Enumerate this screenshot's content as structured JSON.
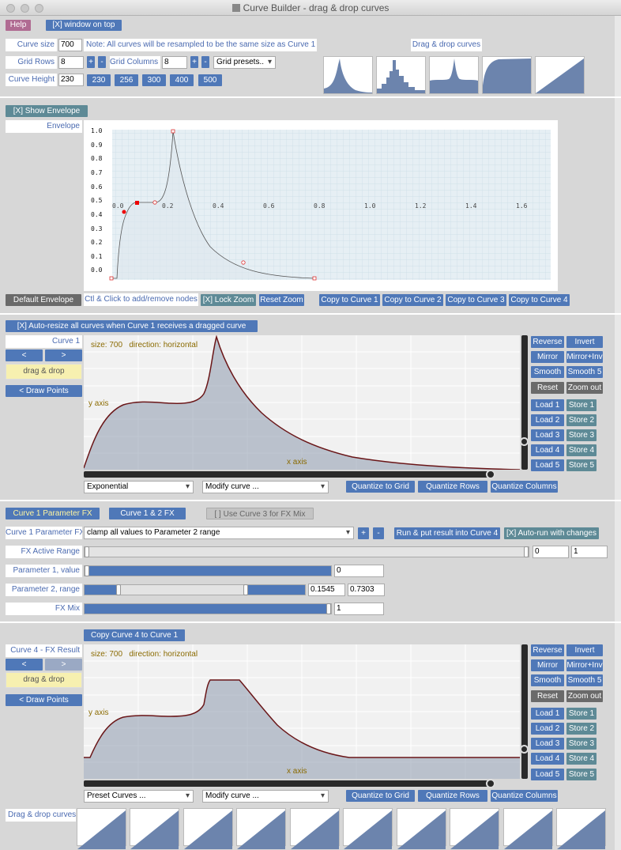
{
  "window": {
    "title": "Curve Builder - drag & drop curves"
  },
  "top": {
    "help": "Help",
    "window_on_top": "[X] window on top",
    "curve_size_label": "Curve size",
    "curve_size_value": "700",
    "note": "Note: All curves will be resampled to be the same size as Curve 1",
    "drag_drop_label": "Drag & drop curves",
    "grid_rows_label": "Grid Rows",
    "grid_rows_value": "8",
    "grid_cols_label": "Grid Columns",
    "grid_cols_value": "8",
    "plus": "+",
    "minus": "-",
    "grid_presets": "Grid presets..",
    "curve_height_label": "Curve Height",
    "curve_height_value": "230",
    "height_presets": [
      "230",
      "256",
      "300",
      "400",
      "500"
    ]
  },
  "envelope": {
    "show_btn": "[X] Show Envelope",
    "label": "Envelope",
    "y_ticks": [
      "1.0",
      "0.9",
      "0.8",
      "0.7",
      "0.6",
      "0.5",
      "0.4",
      "0.3",
      "0.2",
      "0.1",
      "0.0"
    ],
    "x_ticks": [
      "0.0",
      "0.2",
      "0.4",
      "0.6",
      "0.8",
      "1.0",
      "1.2",
      "1.4",
      "1.6"
    ],
    "default_btn": "Default Envelope",
    "hint": "Ctl & Click to add/remove nodes",
    "lock_zoom": "[X] Lock Zoom",
    "reset_zoom": "Reset Zoom",
    "copy_btns": [
      "Copy to Curve 1",
      "Copy to Curve 2",
      "Copy to Curve 3",
      "Copy to Curve 4"
    ]
  },
  "curve1": {
    "auto_resize": "[X] Auto-resize all curves when Curve 1 receives a dragged curve",
    "label": "Curve 1",
    "prev": "<",
    "next": ">",
    "drag_drop": "drag & drop",
    "draw_points": "< Draw Points",
    "info_size": "size: 700",
    "info_dir": "direction: horizontal",
    "y_axis": "y axis",
    "x_axis": "x axis",
    "select_left": "Exponential",
    "select_modify": "Modify curve ...",
    "quantize_grid": "Quantize to Grid",
    "quantize_rows": "Quantize Rows",
    "quantize_cols": "Quantize Columns",
    "side": [
      [
        "Reverse",
        "Invert"
      ],
      [
        "Mirror",
        "Mirror+Inv"
      ],
      [
        "Smooth",
        "Smooth 5"
      ],
      [
        "Reset",
        "Zoom out"
      ],
      [
        "Load 1",
        "Store 1"
      ],
      [
        "Load 2",
        "Store 2"
      ],
      [
        "Load 3",
        "Store 3"
      ],
      [
        "Load 4",
        "Store 4"
      ],
      [
        "Load 5",
        "Store 5"
      ]
    ]
  },
  "fx": {
    "tab1": "Curve 1 Parameter FX",
    "tab2": "Curve 1 & 2 FX",
    "tab3": "[ ] Use Curve 3 for FX Mix",
    "param_fx_label": "Curve 1 Parameter FX",
    "param_fx_value": "clamp all values to Parameter 2 range",
    "plus": "+",
    "minus": "-",
    "run_btn": "Run & put result into Curve 4",
    "autorun_btn": "[X] Auto-run with changes",
    "active_range_label": "FX Active Range",
    "active_range_a": "0",
    "active_range_b": "1",
    "p1_label": "Parameter 1, value",
    "p1_value": "0",
    "p2_label": "Parameter 2, range",
    "p2_a": "0.1545",
    "p2_b": "0.7303",
    "mix_label": "FX Mix",
    "mix_value": "1",
    "p1_level": 1.0,
    "p2_range": [
      0.1545,
      0.7303
    ],
    "mix_level": 1.0
  },
  "curve4": {
    "copy_btn": "Copy Curve 4 to Curve 1",
    "label": "Curve 4 - FX Result",
    "prev": "<",
    "next": ">",
    "drag_drop": "drag & drop",
    "draw_points": "< Draw Points",
    "info_size": "size: 700",
    "info_dir": "direction: horizontal",
    "y_axis": "y axis",
    "x_axis": "x axis",
    "select_left": "Preset Curves ...",
    "select_modify": "Modify curve ...",
    "quantize_grid": "Quantize to Grid",
    "quantize_rows": "Quantize Rows",
    "quantize_cols": "Quantize Columns"
  },
  "bottom": {
    "label": "Drag & drop curves"
  }
}
